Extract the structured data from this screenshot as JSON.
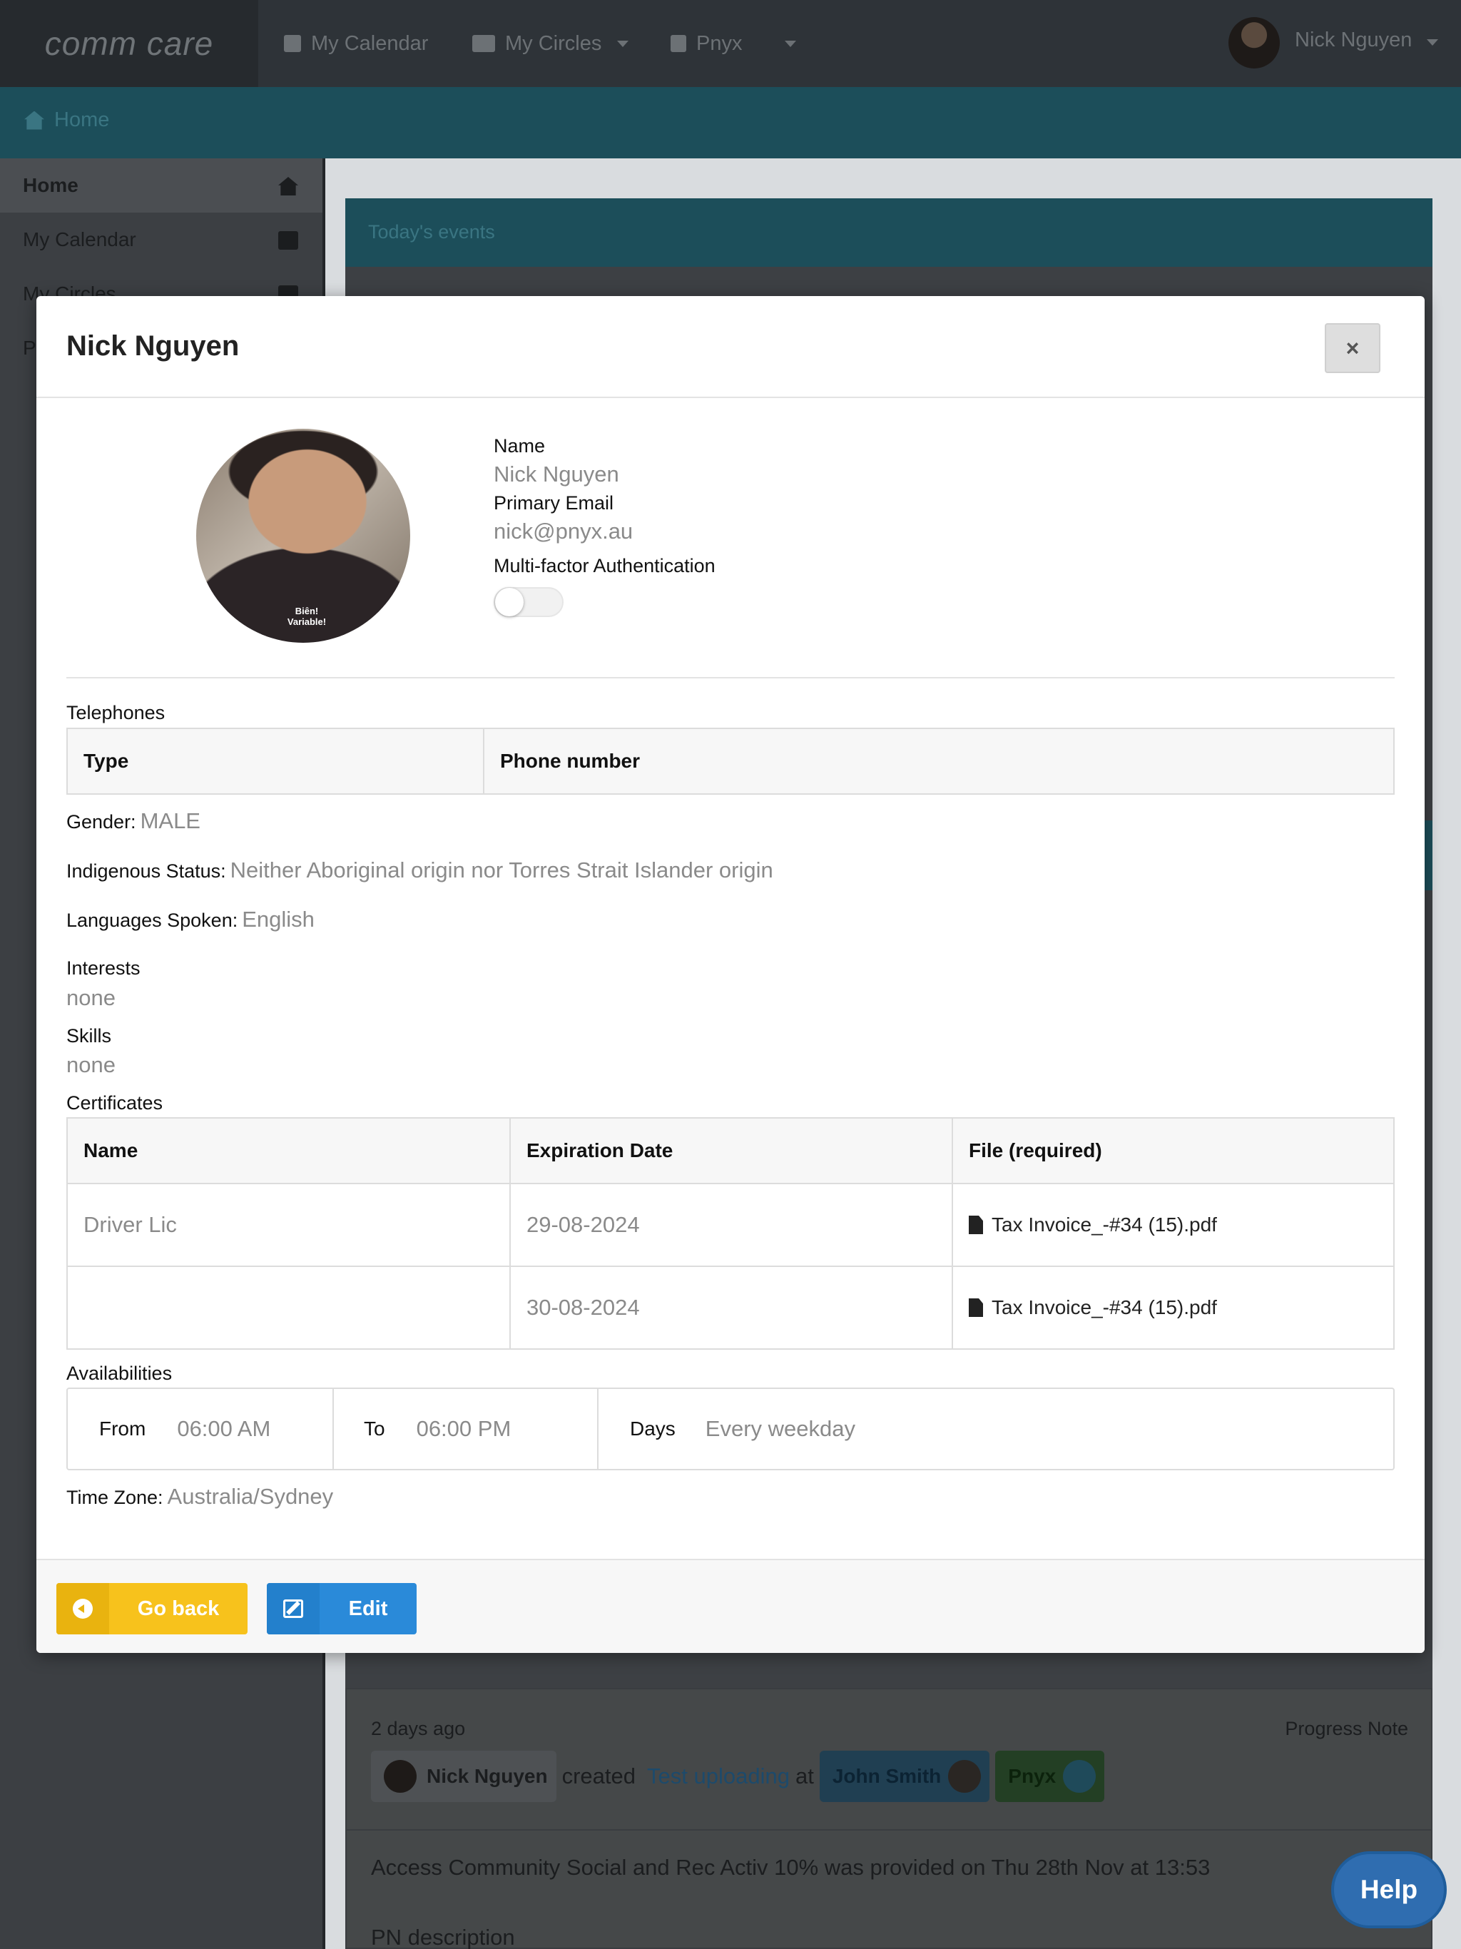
{
  "topbar": {
    "logo": "comm care",
    "nav": [
      {
        "label": "My Calendar",
        "icon": "calendar-icon"
      },
      {
        "label": "My Circles",
        "icon": "users-icon"
      },
      {
        "label": "Pnyx",
        "icon": "building-icon"
      }
    ],
    "user_name": "Nick Nguyen"
  },
  "breadcrumb": {
    "home": "Home"
  },
  "sidebar": {
    "items": [
      {
        "label": "Home"
      },
      {
        "label": "My Calendar"
      },
      {
        "label": "My Circles"
      },
      {
        "label": "P"
      }
    ]
  },
  "dashboard": {
    "todays_events": "Today's events"
  },
  "feed": {
    "time": "2 days ago",
    "type": "Progress Note",
    "actor": "Nick Nguyen",
    "verb": "created",
    "link": "Test uploading",
    "at": "at",
    "client": "John Smith",
    "org": "Pnyx",
    "description": "Access Community Social and Rec Activ 10% was provided on Thu 28th Nov at 13:53",
    "pn": "PN description"
  },
  "modal": {
    "title": "Nick Nguyen",
    "close_icon": "×",
    "avatar_caption": "Biên!\nVariable!",
    "name_label": "Name",
    "name_value": "Nick Nguyen",
    "email_label": "Primary Email",
    "email_value": "nick@pnyx.au",
    "mfa_label": "Multi-factor Authentication",
    "mfa_enabled": false,
    "telephones_label": "Telephones",
    "telephones_headers": [
      "Type",
      "Phone number"
    ],
    "gender_label": "Gender:",
    "gender_value": "MALE",
    "indigenous_label": "Indigenous Status:",
    "indigenous_value": "Neither Aboriginal origin nor Torres Strait Islander origin",
    "languages_label": "Languages Spoken:",
    "languages_value": "English",
    "interests_label": "Interests",
    "interests_value": "none",
    "skills_label": "Skills",
    "skills_value": "none",
    "certificates_label": "Certificates",
    "certificates_headers": [
      "Name",
      "Expiration Date",
      "File (required)"
    ],
    "certificates": [
      {
        "name": "Driver Lic",
        "expiry": "29-08-2024",
        "file": "Tax Invoice_-#34 (15).pdf"
      },
      {
        "name": "",
        "expiry": "30-08-2024",
        "file": "Tax Invoice_-#34 (15).pdf"
      }
    ],
    "availabilities_label": "Availabilities",
    "availability": {
      "from_label": "From",
      "from_value": "06:00 AM",
      "to_label": "To",
      "to_value": "06:00 PM",
      "days_label": "Days",
      "days_value": "Every weekday"
    },
    "timezone_label": "Time Zone:",
    "timezone_value": "Australia/Sydney",
    "go_back_label": "Go back",
    "edit_label": "Edit"
  },
  "help_label": "Help",
  "colors": {
    "primary_teal": "#1c4e5a",
    "go_back_yellow": "#f7c21c",
    "edit_blue": "#2a8ad9",
    "help_blue": "#2f6db0"
  }
}
